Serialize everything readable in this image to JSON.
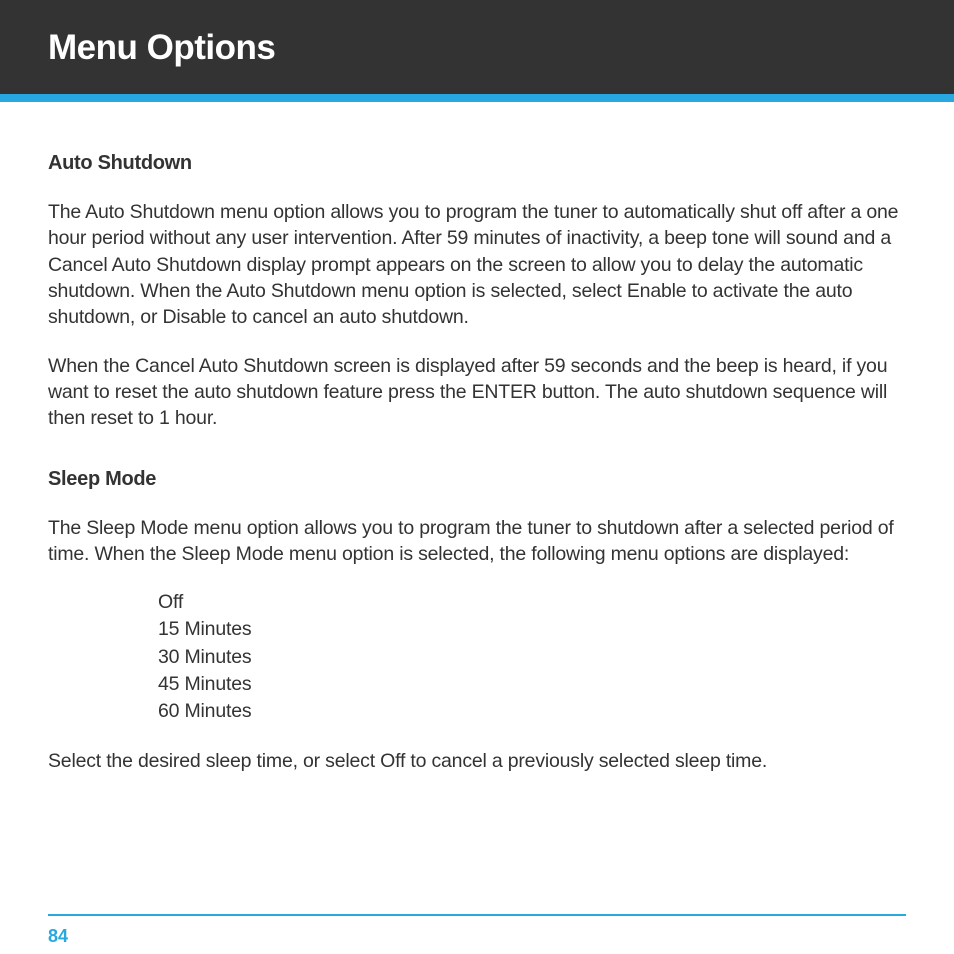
{
  "header": {
    "title": "Menu Options"
  },
  "sections": {
    "auto_shutdown": {
      "heading": "Auto Shutdown",
      "para1": "The Auto Shutdown menu option allows you to program the tuner to automatically shut off after a one hour period without any user intervention. After 59 minutes of inactivity, a beep tone will sound and a Cancel Auto Shutdown display prompt appears on the screen to allow you to delay the automatic shutdown. When the Auto Shutdown menu option is selected, select Enable to activate the auto shutdown, or Disable to cancel an auto shutdown.",
      "para2": "When the Cancel Auto Shutdown screen is displayed after 59 seconds and the beep is heard, if you want to reset the auto shutdown feature press the ENTER button. The auto shutdown sequence will then reset to 1 hour."
    },
    "sleep_mode": {
      "heading": "Sleep Mode",
      "intro": "The Sleep Mode menu option allows you to program the tuner to shutdown after a selected period of time. When the Sleep Mode menu option is selected, the following menu options are displayed:",
      "options": [
        "Off",
        "15 Minutes",
        "30 Minutes",
        "45 Minutes",
        "60 Minutes"
      ],
      "outro": "Select the desired sleep time, or select Off to cancel a previously selected sleep time."
    }
  },
  "footer": {
    "page_number": "84"
  }
}
